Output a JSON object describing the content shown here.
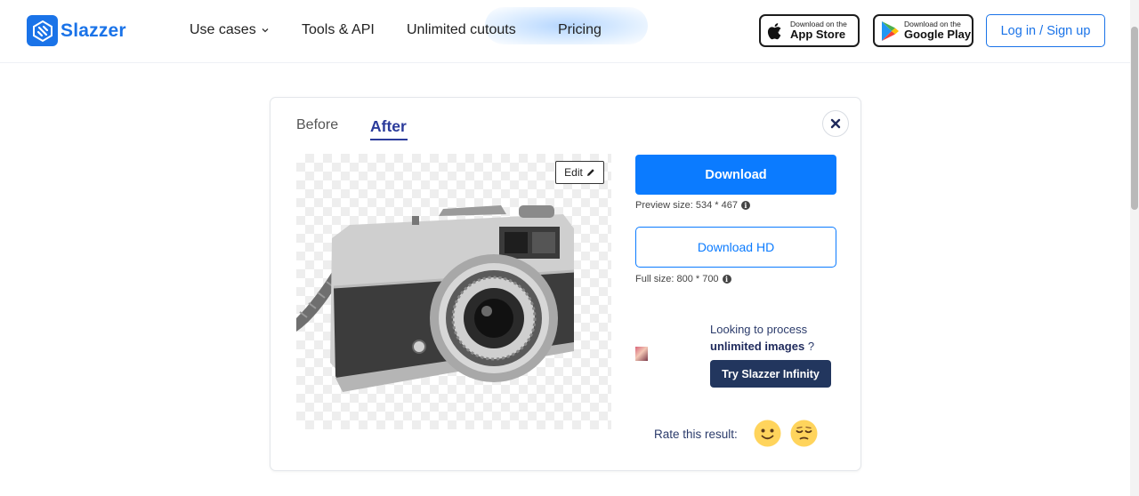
{
  "header": {
    "logo_text": "Slazzer",
    "nav": [
      {
        "label": "Use cases",
        "has_dropdown": true
      },
      {
        "label": "Tools & API"
      },
      {
        "label": "Unlimited cutouts"
      },
      {
        "label": "Pricing"
      }
    ],
    "app_store": {
      "small": "Download on the",
      "big": "App Store"
    },
    "google_play": {
      "small": "Download on the",
      "big": "Google Play"
    },
    "login_label": "Log in / Sign up"
  },
  "card": {
    "tabs": [
      {
        "label": "Before",
        "active": false
      },
      {
        "label": "After",
        "active": true
      }
    ],
    "edit_label": "Edit",
    "download_label": "Download",
    "preview_size_text": "Preview size: 534 * 467",
    "download_hd_label": "Download HD",
    "full_size_text": "Full size: 800 * 700",
    "promo_line1": "Looking to process",
    "promo_bold": "unlimited images",
    "promo_suffix": " ?",
    "infinity_label": "Try Slazzer Infinity",
    "rate_label": "Rate this result:"
  },
  "colors": {
    "brand_blue": "#1a73e8",
    "download_blue": "#0b7bff",
    "active_tab": "#2b3b9b",
    "navy_button": "#22365e"
  },
  "icons": [
    "slazzer-logo-icon",
    "chevron-down-icon",
    "apple-icon",
    "google-play-icon",
    "close-icon",
    "pencil-icon",
    "info-icon",
    "smile-icon",
    "unamused-icon"
  ]
}
